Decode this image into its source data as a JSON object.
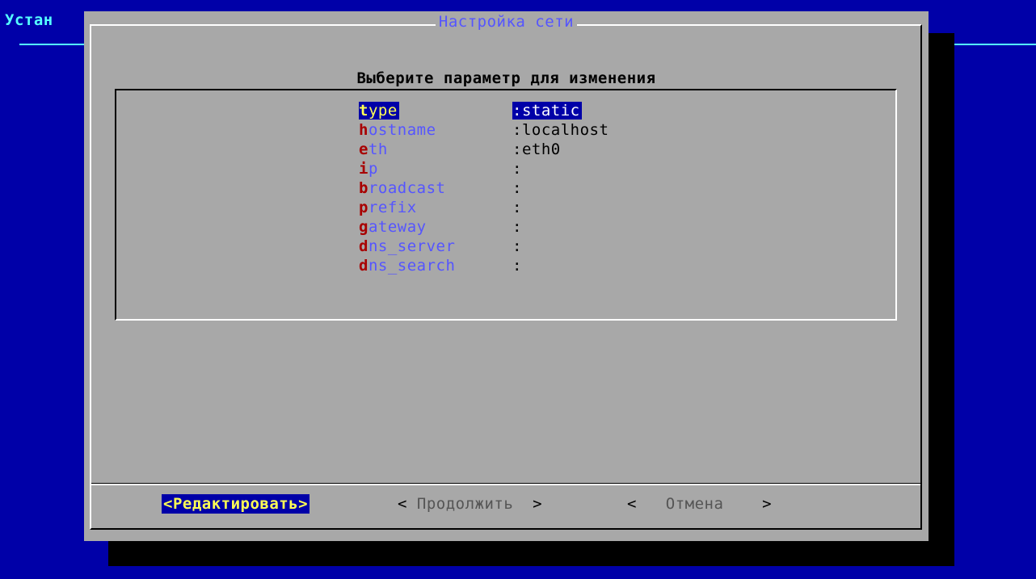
{
  "backtitle": "Устан",
  "dialog": {
    "title": "Настройка сети",
    "prompt": "Выберите параметр для изменения"
  },
  "menu": [
    {
      "key_first": "t",
      "key_rest": "ype",
      "value": ":static",
      "selected": true
    },
    {
      "key_first": "h",
      "key_rest": "ostname",
      "value": ":localhost",
      "selected": false
    },
    {
      "key_first": "e",
      "key_rest": "th",
      "value": ":eth0",
      "selected": false
    },
    {
      "key_first": "i",
      "key_rest": "p",
      "value": ":",
      "selected": false
    },
    {
      "key_first": "b",
      "key_rest": "roadcast",
      "value": ":",
      "selected": false
    },
    {
      "key_first": "p",
      "key_rest": "refix",
      "value": ":",
      "selected": false
    },
    {
      "key_first": "g",
      "key_rest": "ateway",
      "value": ":",
      "selected": false
    },
    {
      "key_first": "d",
      "key_rest": "ns_server",
      "value": ":",
      "selected": false
    },
    {
      "key_first": "d",
      "key_rest": "ns_search",
      "value": ":",
      "selected": false
    }
  ],
  "buttons": {
    "edit": "<Редактировать>",
    "next_open": "< ",
    "next_label": "Продолжить",
    "next_close": "  >",
    "cancel_open": "<   ",
    "cancel_label": "Отмена",
    "cancel_close": "    >"
  },
  "colors": {
    "background": "#0000a8",
    "dialog": "#a8a8a8",
    "hotkey": "#a80000",
    "item_text": "#5555ff",
    "selected_bg": "#0000a8",
    "selected_fg": "#ffff55"
  }
}
